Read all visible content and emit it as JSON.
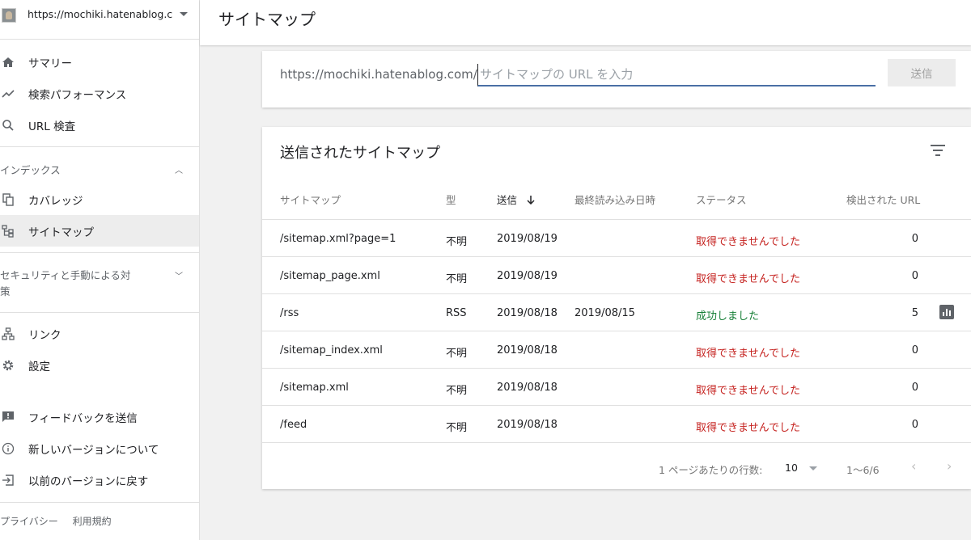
{
  "property": {
    "url": "https://mochiki.hatenablog.c..."
  },
  "nav": {
    "summary": "サマリー",
    "performance": "検索パフォーマンス",
    "url_inspection": "URL 検査",
    "index_section": "インデックス",
    "coverage": "カバレッジ",
    "sitemaps": "サイトマップ",
    "security_section": "セキュリティと手動による対策",
    "links": "リンク",
    "settings": "設定",
    "feedback": "フィードバックを送信",
    "new_version": "新しいバージョンについて",
    "old_version": "以前のバージョンに戻す",
    "privacy": "プライバシー",
    "terms": "利用規約"
  },
  "header": {
    "title": "サイトマップ"
  },
  "add_sitemap": {
    "prefix": "https://mochiki.hatenablog.com/",
    "placeholder": "サイトマップの URL を入力",
    "submit": "送信"
  },
  "table": {
    "title": "送信されたサイトマップ",
    "columns": {
      "sitemap": "サイトマップ",
      "type": "型",
      "submitted": "送信",
      "last_read": "最終読み込み日時",
      "status": "ステータス",
      "discovered": "検出された URL"
    },
    "rows": [
      {
        "sitemap": "/sitemap.xml?page=1",
        "type": "不明",
        "submitted": "2019/08/19",
        "last_read": "",
        "status": "取得できませんでした",
        "discovered": "0"
      },
      {
        "sitemap": "/sitemap_page.xml",
        "type": "不明",
        "submitted": "2019/08/19",
        "last_read": "",
        "status": "取得できませんでした",
        "discovered": "0"
      },
      {
        "sitemap": "/rss",
        "type": "RSS",
        "submitted": "2019/08/18",
        "last_read": "2019/08/15",
        "status": "成功しました",
        "discovered": "5"
      },
      {
        "sitemap": "/sitemap_index.xml",
        "type": "不明",
        "submitted": "2019/08/18",
        "last_read": "",
        "status": "取得できませんでした",
        "discovered": "0"
      },
      {
        "sitemap": "/sitemap.xml",
        "type": "不明",
        "submitted": "2019/08/18",
        "last_read": "",
        "status": "取得できませんでした",
        "discovered": "0"
      },
      {
        "sitemap": "/feed",
        "type": "不明",
        "submitted": "2019/08/18",
        "last_read": "",
        "status": "取得できませんでした",
        "discovered": "0"
      }
    ],
    "pagination": {
      "rows_per_page_label": "1 ページあたりの行数:",
      "rows_per_page": "10",
      "range": "1～6/6"
    }
  },
  "colors": {
    "error": "#c5221f",
    "success": "#188038",
    "input_underline": "#4a6fa5"
  }
}
